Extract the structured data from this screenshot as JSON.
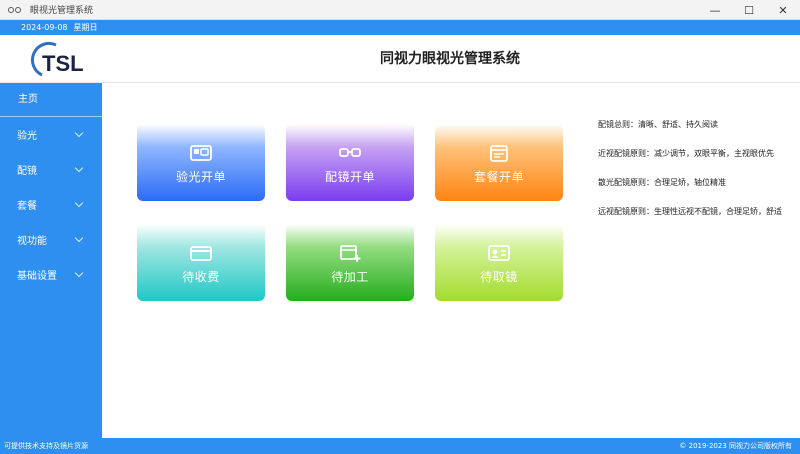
{
  "window": {
    "title": "眼视光管理系统",
    "controls": {
      "minimize": "—",
      "maximize": "☐",
      "close": "✕"
    }
  },
  "datebar": {
    "date": "2024-09-08",
    "weekday": "星期日"
  },
  "header": {
    "logo_text": "TSL",
    "title": "同视力眼视光管理系统"
  },
  "sidebar": {
    "home": "主页",
    "items": [
      {
        "label": "验光"
      },
      {
        "label": "配镜"
      },
      {
        "label": "套餐"
      },
      {
        "label": "视功能"
      },
      {
        "label": "基础设置"
      }
    ]
  },
  "tiles": [
    {
      "label": "验光开单",
      "icon": "camera-icon"
    },
    {
      "label": "配镜开单",
      "icon": "glasses-icon"
    },
    {
      "label": "套餐开单",
      "icon": "calendar-icon"
    },
    {
      "label": "待收费",
      "icon": "card-icon"
    },
    {
      "label": "待加工",
      "icon": "add-document-icon"
    },
    {
      "label": "待取镜",
      "icon": "id-card-icon"
    }
  ],
  "info": [
    "配镜总则：清晰、舒适、持久阅读",
    "近视配镜原则：减少调节，双眼平衡，主视眼优先",
    "散光配镜原则：合理足矫，轴位精准",
    "远视配镜原则：生理性远视不配镜，合理足矫，舒适"
  ],
  "footer": {
    "left": "可提供技术支持及镜片货源",
    "right": "© 2019-2023 同视力公司版权所有"
  },
  "colors": {
    "primary": "#2e8ff0"
  }
}
